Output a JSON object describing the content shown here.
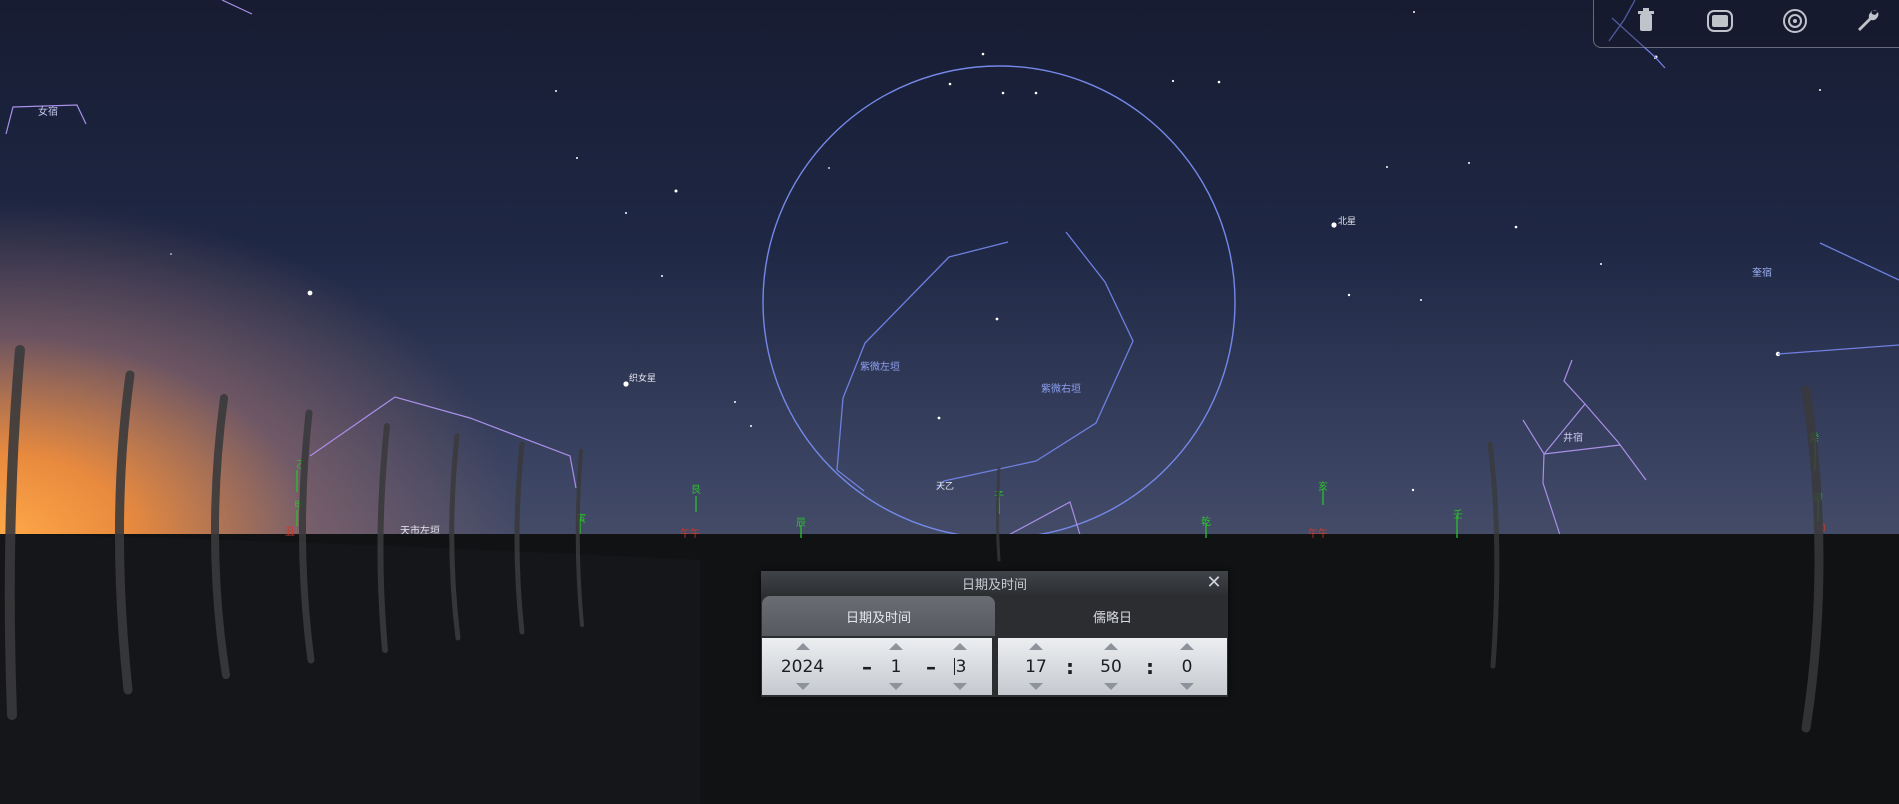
{
  "sky_labels": {
    "nvsu": "女宿",
    "zhiwei_left": "紫微左垣",
    "zhiwei_right": "紫微右垣",
    "zhinv": "织女星",
    "tianyi": "天乙",
    "tianshi_left": "天市左垣",
    "beixing": "北星",
    "kuisu": "奎宿",
    "jingsu": "井宿",
    "unknown_left": "乙"
  },
  "horizon_labels": [
    "乙",
    "甲",
    "艮",
    "寅",
    "辰",
    "子",
    "乾",
    "亥",
    "壬",
    "癸",
    "丑",
    "艮",
    "卯"
  ],
  "toolbar": {
    "icons": [
      "trash-icon",
      "fullscreen-icon",
      "target-icon",
      "wrench-icon"
    ]
  },
  "dialog": {
    "title": "日期及时间",
    "close_symbol": "✕",
    "tab_datetime": "日期及时间",
    "tab_julian": "儒略日",
    "year": "2024",
    "month": "1",
    "day": "3",
    "hour": "17",
    "minute": "50",
    "second": "0",
    "date_sep": "–",
    "time_sep": ":"
  },
  "colors": {
    "constellation_line": "#6f7fe0",
    "boundary_line": "#a98fe8",
    "cardinal_green": "#2bbf2b",
    "cardinal_red": "#c83a2e"
  }
}
